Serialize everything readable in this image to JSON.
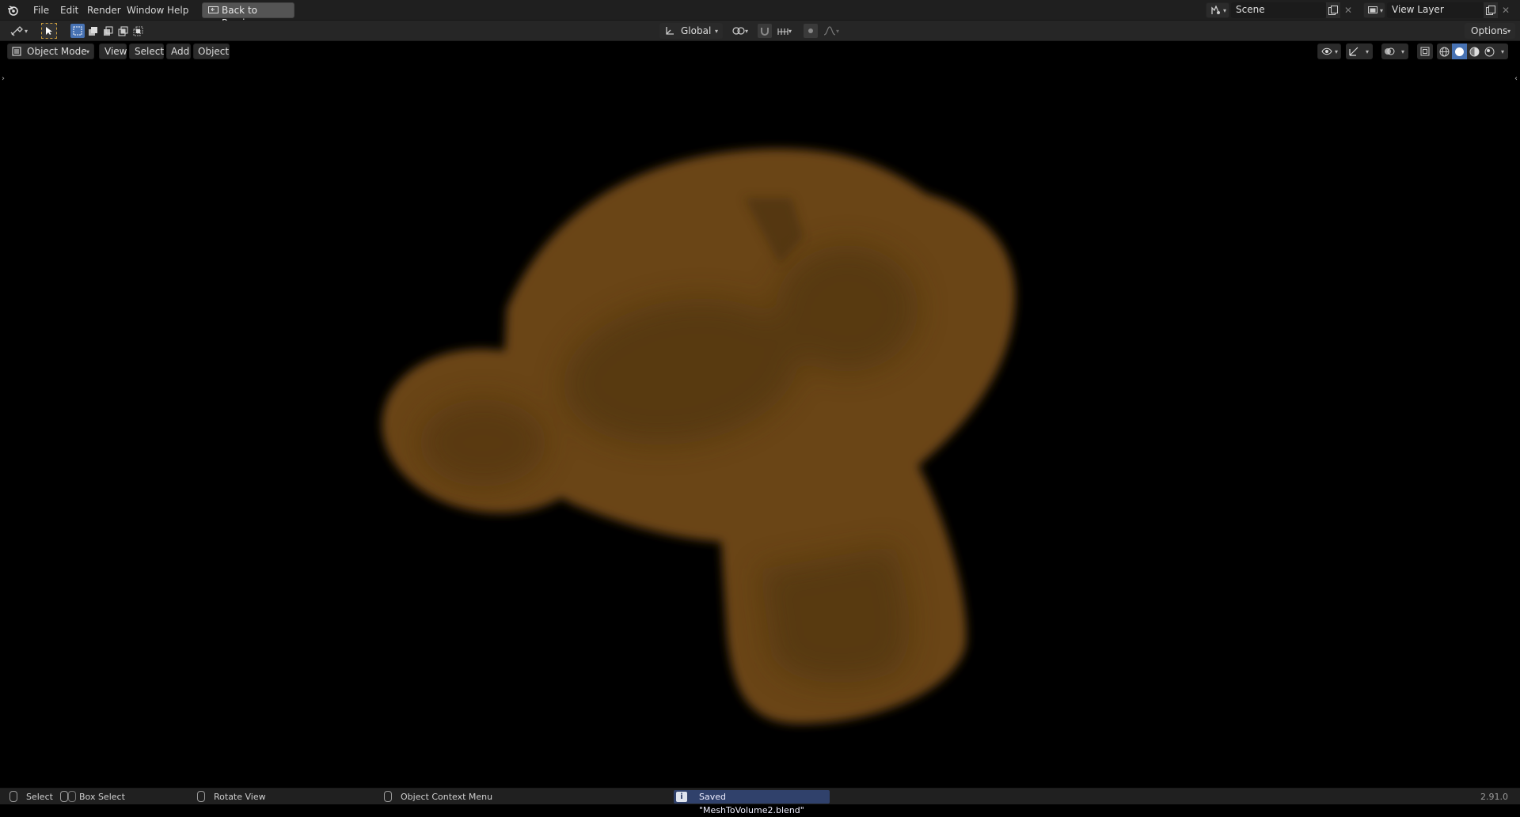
{
  "topbar": {
    "menus": [
      "File",
      "Edit",
      "Render",
      "Window",
      "Help"
    ],
    "back_button": "Back to Previous",
    "scene": "Scene",
    "view_layer": "View Layer"
  },
  "toolheader": {
    "transform_orientation": "Global",
    "options": "Options"
  },
  "viewheader": {
    "mode": "Object Mode",
    "menus": [
      "View",
      "Select",
      "Add",
      "Object"
    ]
  },
  "viewport": {
    "object": "volume-monkey",
    "color": "#6a4515"
  },
  "statusbar": {
    "select": "Select",
    "box_select": "Box Select",
    "rotate_view": "Rotate View",
    "context_menu": "Object Context Menu",
    "report": "Saved \"MeshToVolume2.blend\"",
    "version": "2.91.0"
  },
  "colors": {
    "accent": "#4772b3",
    "report_bg": "#30416b",
    "header_bg": "#262626",
    "topbar_bg": "#1f1f1f"
  }
}
